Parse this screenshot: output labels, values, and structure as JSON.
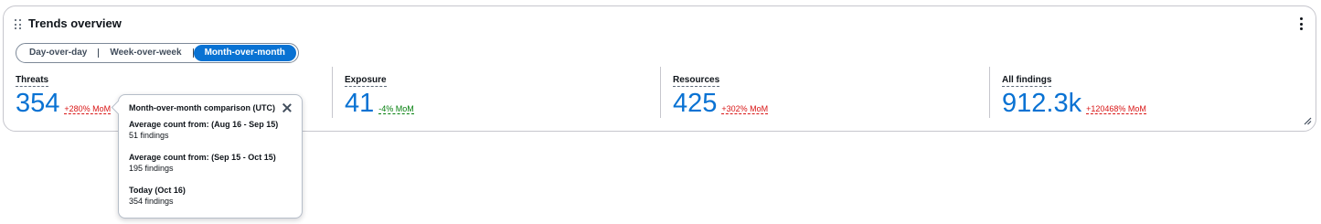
{
  "widget": {
    "title": "Trends overview",
    "drag_icon": "drag-handle-icon",
    "menu_icon": "vertical-dots-icon",
    "resize_icon": "resize-corner-icon"
  },
  "segmented_control": {
    "options": [
      {
        "label": "Day-over-day",
        "selected": false
      },
      {
        "label": "Week-over-week",
        "selected": false
      },
      {
        "label": "Month-over-month",
        "selected": true
      }
    ]
  },
  "metrics": [
    {
      "label": "Threats",
      "value": "354",
      "change": "+280% MoM",
      "trend": "up"
    },
    {
      "label": "Exposure",
      "value": "41",
      "change": "-4% MoM",
      "trend": "down"
    },
    {
      "label": "Resources",
      "value": "425",
      "change": "+302% MoM",
      "trend": "up"
    },
    {
      "label": "All findings",
      "value": "912.3k",
      "change": "+120468% MoM",
      "trend": "up"
    }
  ],
  "popover": {
    "title": "Month-over-month comparison (UTC)",
    "sections": [
      {
        "heading": "Average count from: (Aug 16 - Sep 15)",
        "value": "51 findings"
      },
      {
        "heading": "Average count from: (Sep 15 - Oct 15)",
        "value": "195 findings"
      },
      {
        "heading": "Today (Oct 16)",
        "value": "354 findings"
      }
    ]
  },
  "colors": {
    "accent": "#0972d3",
    "negative_change": "#d91515",
    "positive_change": "#037f0c"
  }
}
